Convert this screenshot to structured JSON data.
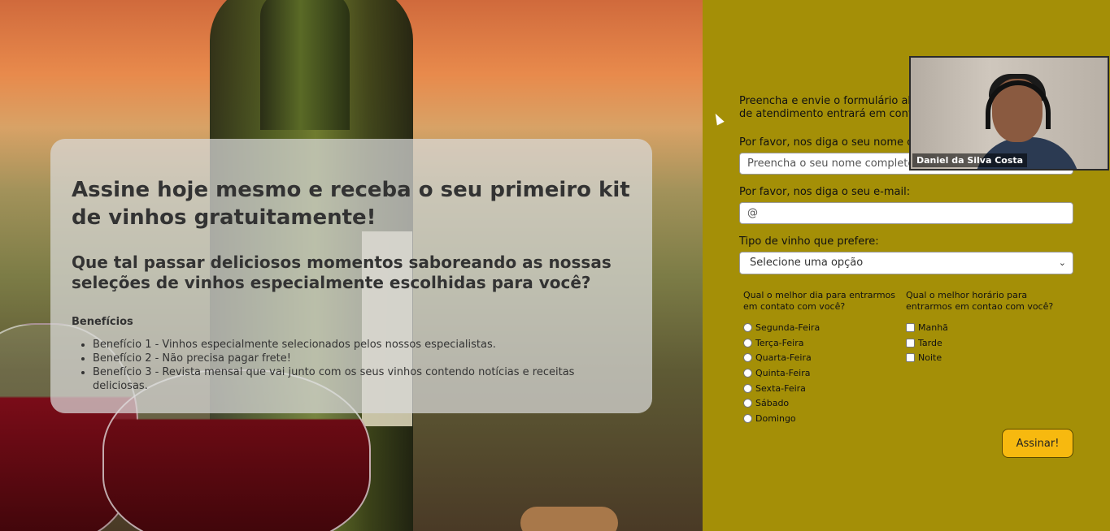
{
  "hero": {
    "title": "Assine hoje mesmo e receba o seu primeiro kit de vinhos gratuitamente!",
    "subtitle": "Que tal passar deliciosos momentos saboreando as nossas seleções de vinhos especialmente escolhidas para você?",
    "benefits_heading": "Benefícios",
    "benefits": [
      "Benefício 1 - Vinhos especialmente selecionados pelos nossos especialistas.",
      "Benefício 2 - Não precisa pagar frete!",
      "Benefício 3 - Revista mensal que vai junto com os seus vinhos contendo notícias e receitas deliciosas."
    ]
  },
  "form": {
    "intro_line1": "Preencha e envie o formulário ab",
    "intro_line2": "de atendimento entrará em cont",
    "name_label": "Por favor, nos diga o seu nome co",
    "name_placeholder": "Preencha o seu nome completo",
    "email_label": "Por favor, nos diga o seu e-mail:",
    "email_placeholder": "@",
    "wine_label": "Tipo de vinho que prefere:",
    "wine_select": "Selecione uma opção",
    "day_question": "Qual o melhor dia para entrarmos em contato com você?",
    "days": [
      "Segunda-Feira",
      "Terça-Feira",
      "Quarta-Feira",
      "Quinta-Feira",
      "Sexta-Feira",
      "Sábado",
      "Domingo"
    ],
    "time_question": "Qual o melhor horário para entrarmos em contao com você?",
    "times": [
      "Manhã",
      "Tarde",
      "Noite"
    ],
    "submit_label": "Assinar!"
  },
  "video_overlay": {
    "participant_name": "Daniel da Silva Costa"
  },
  "colors": {
    "form_background": "#a48f07",
    "submit_button": "#f7b90f",
    "card_background": "rgba(218,218,218,0.72)"
  },
  "icons": {
    "select_arrow": "chevron-down-icon",
    "cursor": "mouse-pointer-icon"
  }
}
